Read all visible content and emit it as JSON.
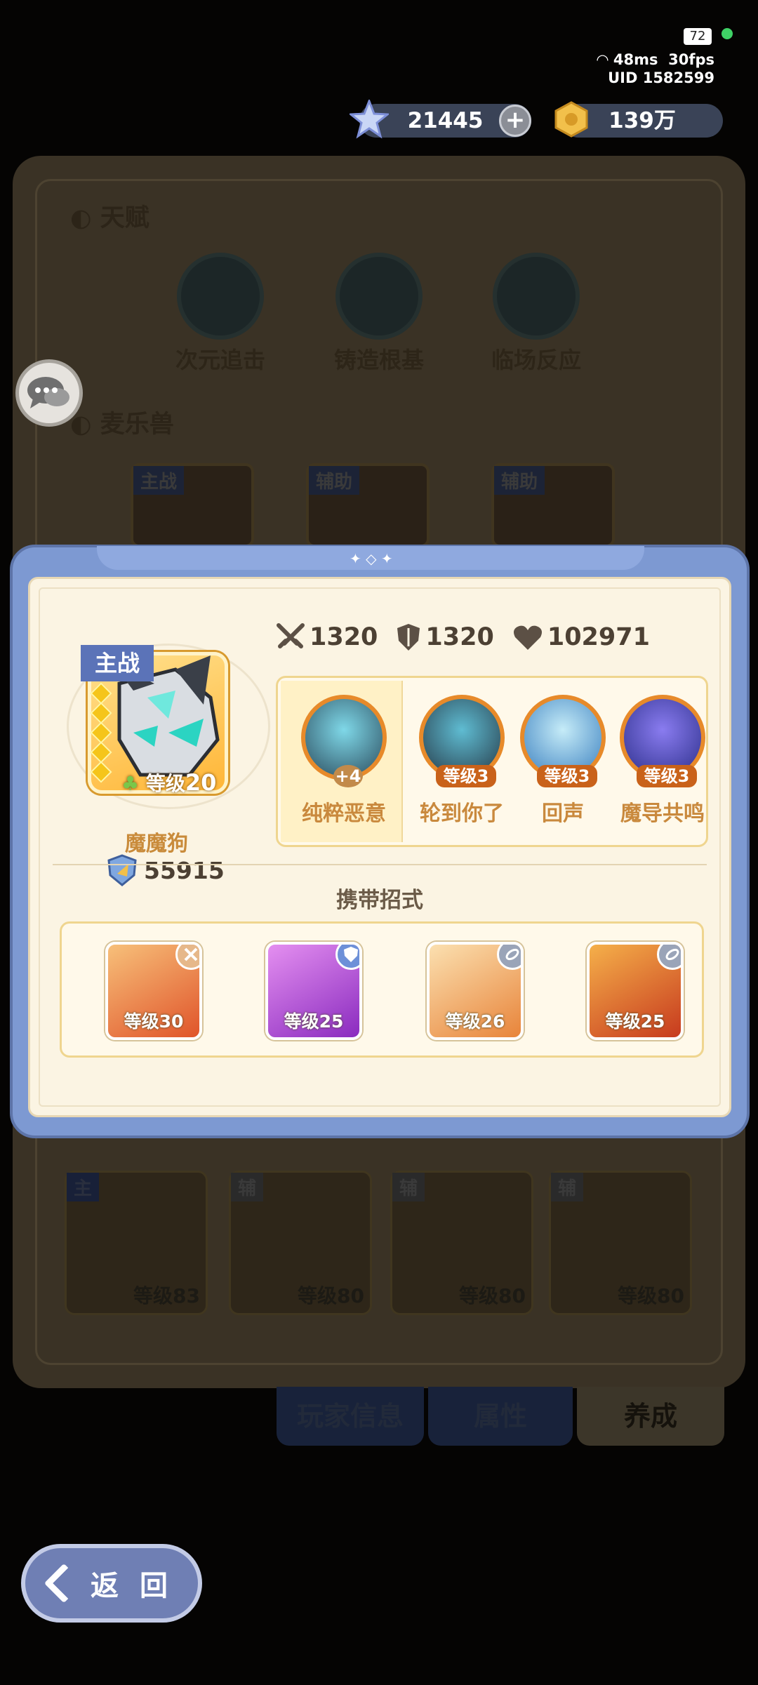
{
  "status": {
    "battery": "72",
    "ping": "48ms",
    "fps": "30fps",
    "uid": "UID 1582599"
  },
  "currency": {
    "gems": "21445",
    "coins": "139万"
  },
  "background": {
    "talent_title": "天赋",
    "talents": [
      "次元追击",
      "铸造根基",
      "临场反应"
    ],
    "pets_title": "麦乐兽",
    "pet_tags": [
      "主战",
      "辅助",
      "辅助"
    ],
    "bottom_cards": [
      {
        "role": "主",
        "level": "等级83"
      },
      {
        "role": "辅",
        "level": "等级80"
      },
      {
        "role": "辅",
        "level": "等级80"
      },
      {
        "role": "辅",
        "level": "等级80"
      }
    ],
    "tabs": [
      "玩家信息",
      "属性",
      "养成"
    ]
  },
  "back_label": "返 回",
  "modal": {
    "main_tag": "主战",
    "pet_level_prefix": "等级",
    "pet_level": "20",
    "pet_name": "魔魔狗",
    "power": "55915",
    "stats": {
      "attack": "1320",
      "defense": "1320",
      "hp": "102971"
    },
    "skills": [
      {
        "name": "纯粹恶意",
        "badge": "+4"
      },
      {
        "name": "轮到你了",
        "badge": "等级3"
      },
      {
        "name": "回声",
        "badge": "等级3"
      },
      {
        "name": "魔导共鸣",
        "badge": "等级3"
      }
    ],
    "carry_title": "携带招式",
    "moves": [
      {
        "level": "等级30",
        "color": "#ee7a38"
      },
      {
        "level": "等级25",
        "color": "#b451d6"
      },
      {
        "level": "等级26",
        "color": "#f0a24a"
      },
      {
        "level": "等级25",
        "color": "#e66a2a"
      }
    ]
  }
}
